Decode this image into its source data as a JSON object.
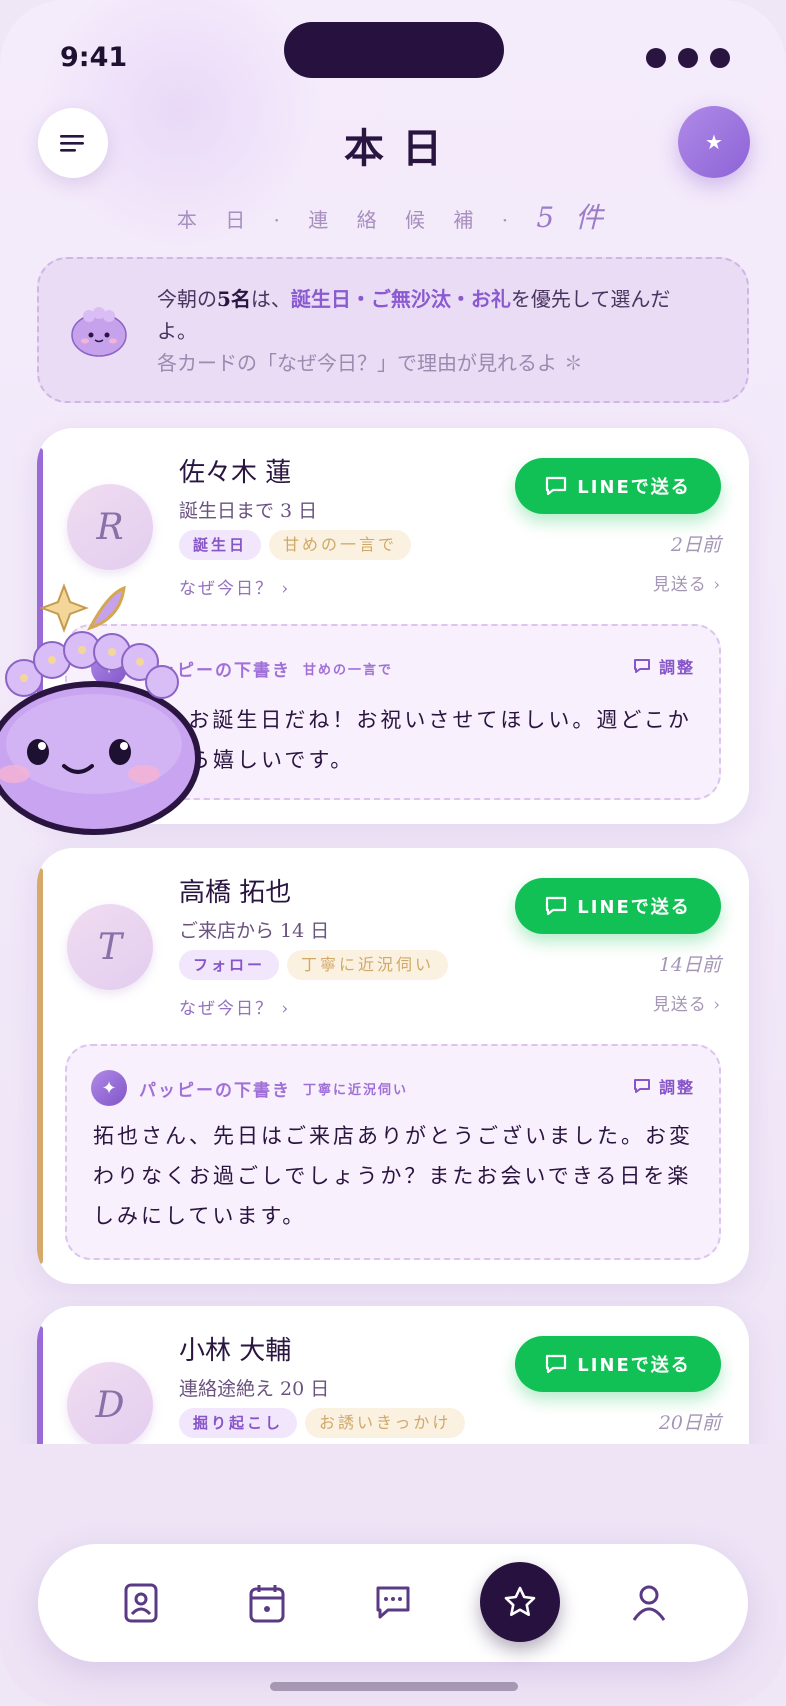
{
  "status": {
    "time": "9:41"
  },
  "header": {
    "title": "本日",
    "subtitle_prefix": "本 日 · 連 絡 候 補 ·",
    "subtitle_count": "5 件"
  },
  "notice": {
    "line1_a": "今朝の",
    "line1_b": "5名",
    "line1_c": "は、",
    "line1_hl": "誕生日・ご無沙汰・お礼",
    "line1_d": "を優先して選んだよ。",
    "line2": "各カードの「なぜ今日？」で理由が見れるよ ✽"
  },
  "contacts": [
    {
      "initial": "R",
      "name": "佐々木 蓮",
      "meta": "誕生日まで 3 日",
      "tags": [
        "誕生日",
        "甘めの一言で"
      ],
      "ago": "2日前",
      "why": "なぜ今日？ ›",
      "skip": "見送る ›",
      "line_label": "LINEで送る",
      "bar_color": "#9a6ad8",
      "draft": {
        "label": "パッピーの下書き",
        "tone": "甘めの一言で",
        "adjust": "調整",
        "body": "もうすぐお誕生日だね！お祝いさせてほしい。週どこかで会えたら嬉しいです。"
      }
    },
    {
      "initial": "T",
      "name": "高橋 拓也",
      "meta": "ご来店から 14 日",
      "tags": [
        "フォロー",
        "丁寧に近況伺い"
      ],
      "ago": "14日前",
      "why": "なぜ今日？ ›",
      "skip": "見送る ›",
      "line_label": "LINEで送る",
      "bar_color": "#d6a86a",
      "draft": {
        "label": "パッピーの下書き",
        "tone": "丁寧に近況伺い",
        "adjust": "調整",
        "body": "拓也さん、先日はご来店ありがとうございました。お変わりなくお過ごしでしょうか？またお会いできる日を楽しみにしています。"
      }
    },
    {
      "initial": "D",
      "name": "小林 大輔",
      "meta": "連絡途絶え 20 日",
      "tags": [
        "掘り起こし",
        "お誘いきっかけ"
      ],
      "ago": "20日前",
      "line_label": "LINEで送る",
      "bar_color": "#9a6ad8"
    }
  ],
  "nav": {
    "items": [
      "contacts-icon",
      "calendar-icon",
      "chat-icon",
      "star-icon",
      "profile-icon"
    ]
  }
}
